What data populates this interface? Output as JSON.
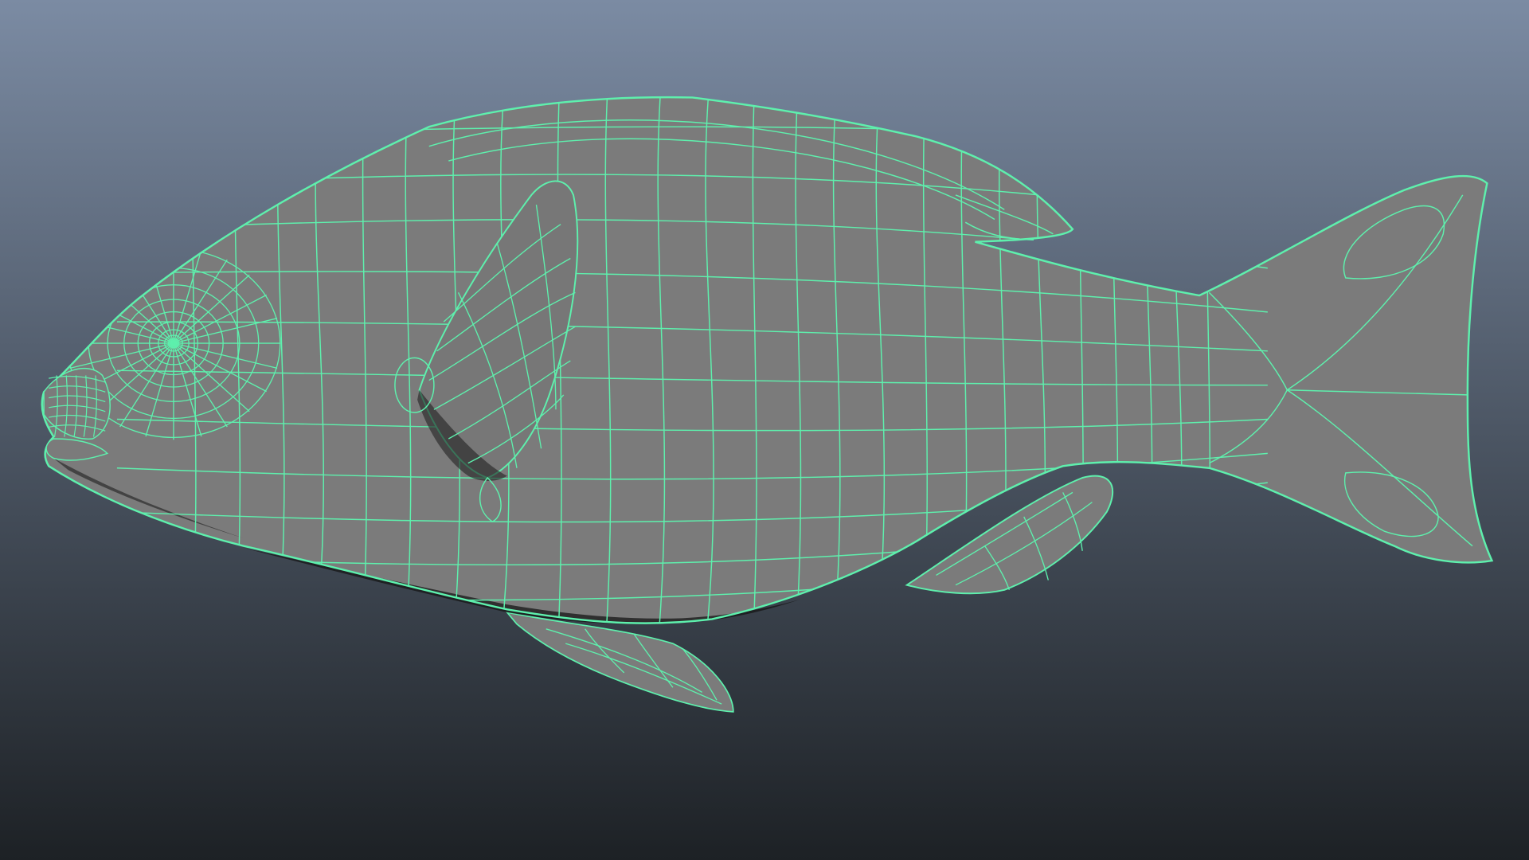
{
  "viewport": {
    "background_top": "#7b8ba3",
    "background_bottom": "#1d2125",
    "surface_color": "#7b7b7b",
    "surface_shadow": "#161616",
    "wireframe_color": "#5ef0ad"
  },
  "model": {
    "icon": "fish-mesh-icon",
    "display_mode": "wireframe-on-shaded"
  }
}
